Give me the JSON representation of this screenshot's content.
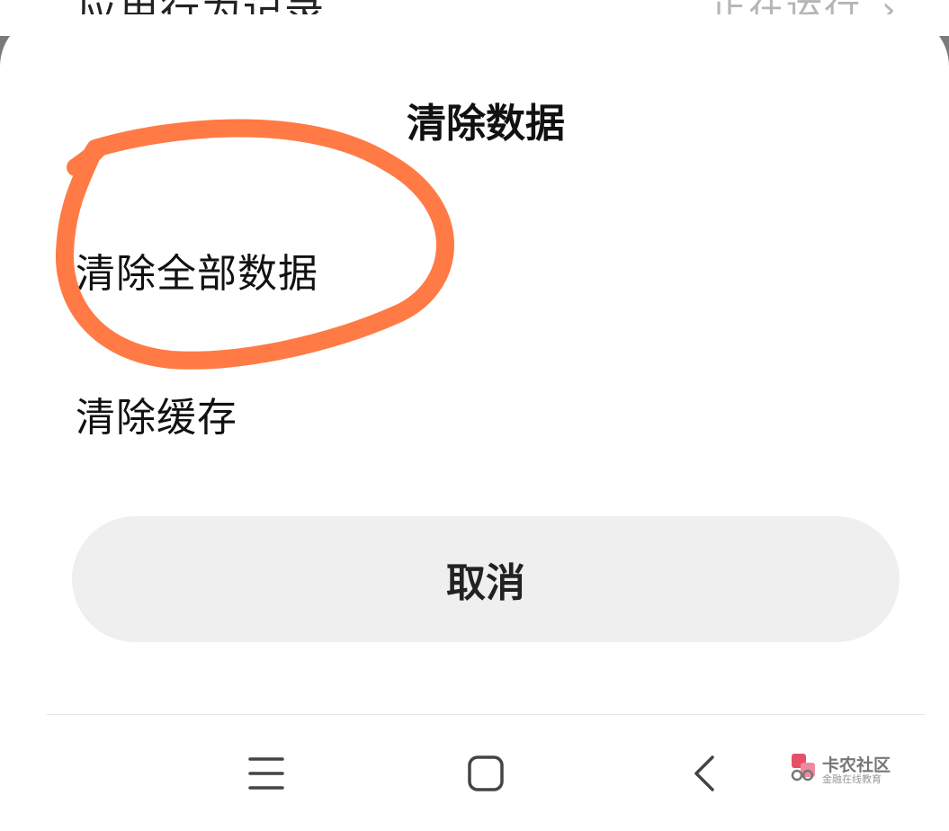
{
  "background": {
    "title": "应用行为记录",
    "status": "正在运行"
  },
  "dialog": {
    "title": "清除数据",
    "options": [
      {
        "label": "清除全部数据",
        "highlighted": true
      },
      {
        "label": "清除缓存",
        "highlighted": false
      }
    ],
    "cancel_label": "取消"
  },
  "nav_bar": {
    "buttons": [
      "menu-icon",
      "home-icon",
      "back-icon"
    ]
  },
  "annotation": {
    "shape": "hand-drawn circle",
    "color": "#ff7a45"
  },
  "watermark": {
    "name": "卡农社区",
    "subtitle": "金融在线教育"
  },
  "colors": {
    "cancel_bg": "#efefef",
    "scrim": "#7a7a7a",
    "sheet": "#ffffff"
  }
}
